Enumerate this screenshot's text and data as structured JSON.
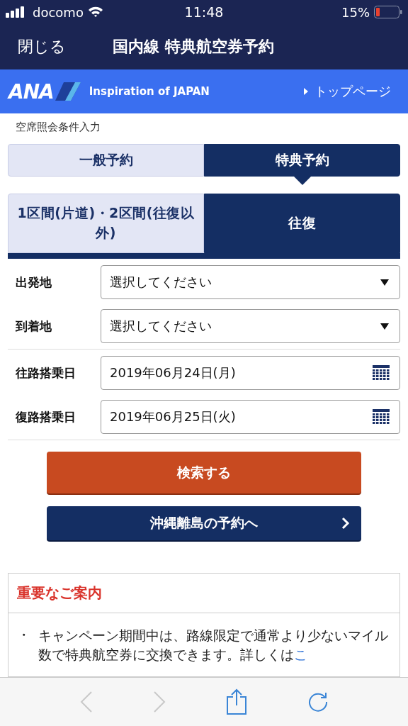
{
  "status_bar": {
    "carrier": "docomo",
    "time": "11:48",
    "battery": "15%"
  },
  "nav": {
    "close": "閉じる",
    "title": "国内線 特典航空券予約"
  },
  "brand": {
    "logo": "ANA",
    "tagline": "Inspiration of JAPAN",
    "top_link": "トップページ"
  },
  "section_label": "空席照会条件入力",
  "booking_tabs": [
    {
      "label": "一般予約",
      "selected": false
    },
    {
      "label": "特典予約",
      "selected": true
    }
  ],
  "trip_tabs": [
    {
      "label": "1区間(片道)・2区間(往復以外)",
      "selected": false
    },
    {
      "label": "往復",
      "selected": true
    }
  ],
  "form_groups": [
    [
      {
        "label": "出発地",
        "kind": "select",
        "value": "選択してください"
      },
      {
        "label": "到着地",
        "kind": "select",
        "value": "選択してください"
      }
    ],
    [
      {
        "label": "往路搭乗日",
        "kind": "date",
        "value": "2019年06月24日(月)"
      },
      {
        "label": "復路搭乗日",
        "kind": "date",
        "value": "2019年06月25日(火)"
      }
    ]
  ],
  "buttons": [
    {
      "label": "検索する",
      "kind": "primary"
    },
    {
      "label": "沖縄離島の予約へ",
      "kind": "link"
    }
  ],
  "notice": {
    "title": "重要なご案内",
    "bullet": "・",
    "text": "キャンペーン期間中は、路線限定で通常より少ないマイル数で特典航空券に交換できます。詳しくは",
    "link": "こ"
  },
  "browser_toolbar": {
    "back_disabled": true,
    "forward_disabled": true
  }
}
